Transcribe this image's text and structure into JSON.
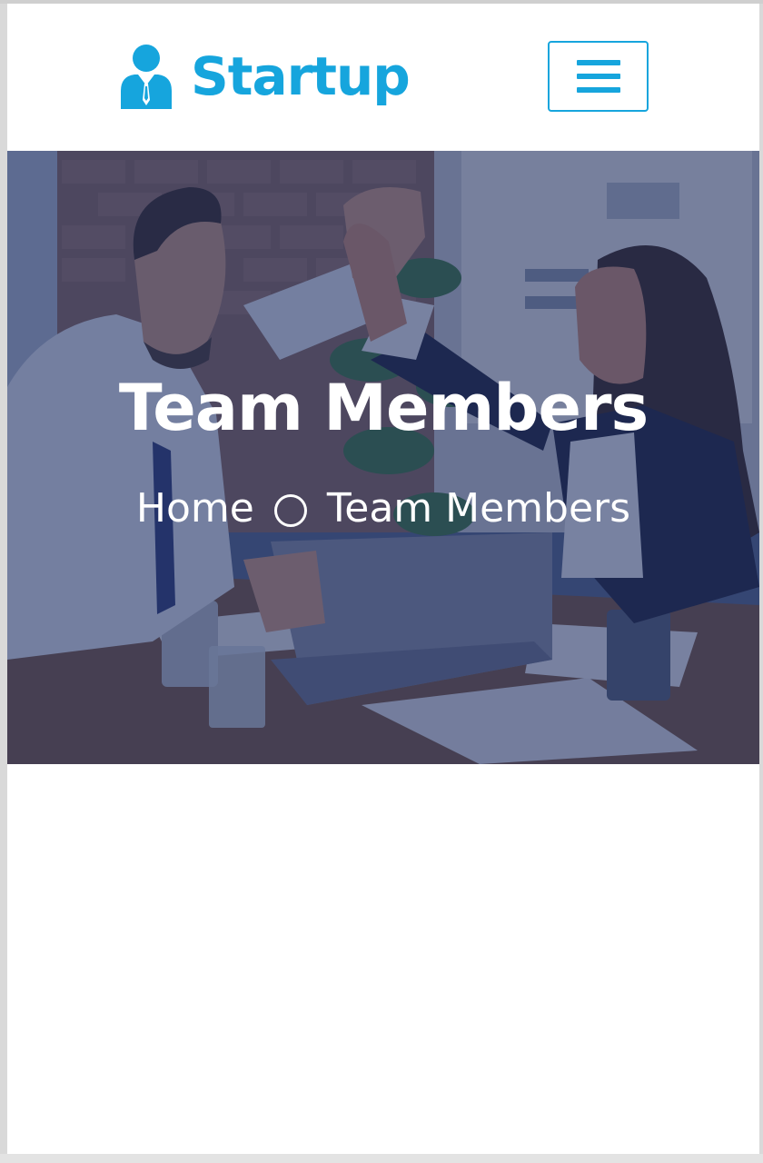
{
  "navbar": {
    "brand_name": "Startup",
    "brand_icon": "user-tie-icon",
    "menu_icon": "hamburger-menu-icon"
  },
  "hero": {
    "title": "Team Members",
    "breadcrumb": {
      "home": "Home",
      "separator_icon": "circle-outline-icon",
      "current": "Team Members"
    }
  },
  "colors": {
    "brand": "#16a5dd",
    "overlay": "#1c2a5c",
    "text_light": "#ffffff"
  }
}
